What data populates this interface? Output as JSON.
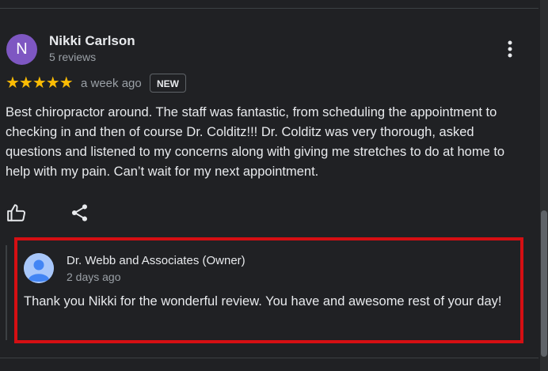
{
  "review": {
    "avatar_letter": "N",
    "avatar_color": "#7e57c2",
    "reviewer_name": "Nikki Carlson",
    "review_count": "5 reviews",
    "rating": 5,
    "stars_display": "★★★★★",
    "date": "a week ago",
    "badge": "NEW",
    "text": "Best chiropractor around. The staff was fantastic, from scheduling the appointment to checking in and then of course Dr. Colditz!!! Dr. Colditz was very thorough, asked questions and listened to my concerns along with giving me stretches to do at home to help with my pain. Can’t wait for my next appointment.",
    "icons": {
      "more": "more-vert-icon",
      "like": "thumb-up-icon",
      "share": "share-icon"
    }
  },
  "reply": {
    "owner_name": "Dr. Webb and Associates (Owner)",
    "date": "2 days ago",
    "text": "Thank you Nikki for the wonderful review. You have and awesome rest of your day!",
    "avatar_icon": "person-avatar-icon",
    "highlight_color": "#d50f13"
  },
  "colors": {
    "background": "#202124",
    "star": "#fbbc04",
    "text_primary": "#e8eaed",
    "text_secondary": "#9aa0a6"
  }
}
